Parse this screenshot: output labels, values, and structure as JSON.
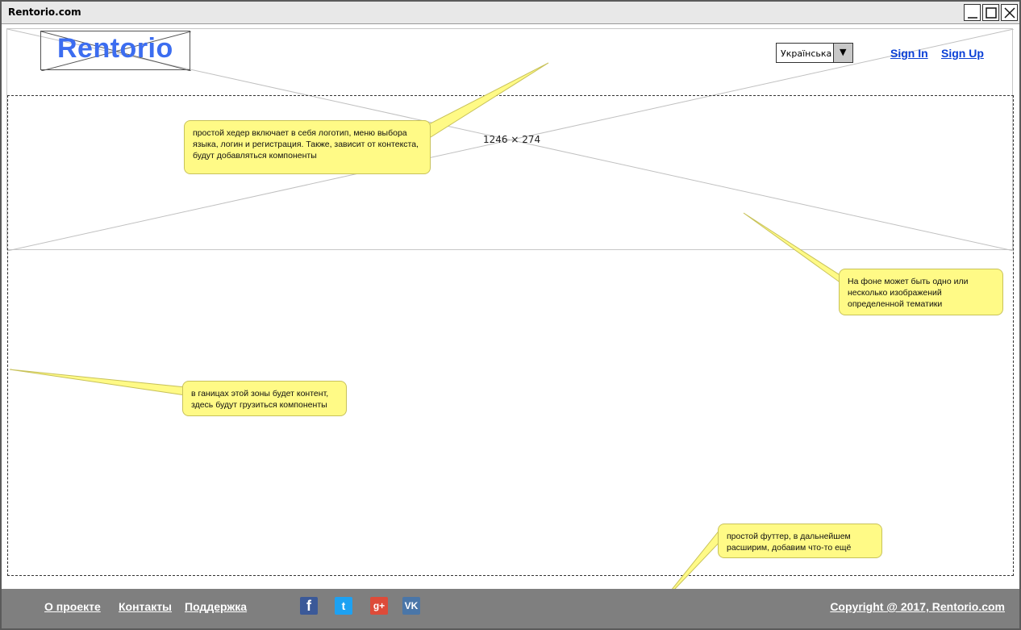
{
  "window": {
    "title": "Rentorio.com",
    "controls": [
      "minimize-icon",
      "maximize-icon",
      "close-icon"
    ]
  },
  "header": {
    "placeholder_label": "1246 × 274",
    "logo_text": "Rentorio",
    "logo_placeholder_caption": "image.png",
    "language": {
      "selected": "Українська"
    },
    "sign_in": "Sign In",
    "sign_up": "Sign Up"
  },
  "notes": {
    "header_note": "простой хедер включает в себя логотип, меню выбора языка, логин и регистрация. Также, зависит от контекста, будут добавляться компоненты",
    "background_note": "На фоне может быть одно или несколько изображений определенной тематики",
    "content_note": "в ганицах этой зоны будет контент, здесь будут грузиться компоненты",
    "footer_note": "простой футтер, в дальнейшем расширим, добавим что-то ещё"
  },
  "footer": {
    "links": [
      "О проекте",
      "Контакты",
      "Поддержка"
    ],
    "social": [
      {
        "icon": "facebook-icon",
        "glyph": "f",
        "color": "#3b5998"
      },
      {
        "icon": "twitter-icon",
        "glyph": "t",
        "color": "#1da1f2"
      },
      {
        "icon": "google-plus-icon",
        "glyph": "g+",
        "color": "#dd4b39"
      },
      {
        "icon": "vk-icon",
        "glyph": "VK",
        "color": "#4a76a8"
      }
    ],
    "copyright": "Copyright @ 2017, Rentorio.com"
  }
}
